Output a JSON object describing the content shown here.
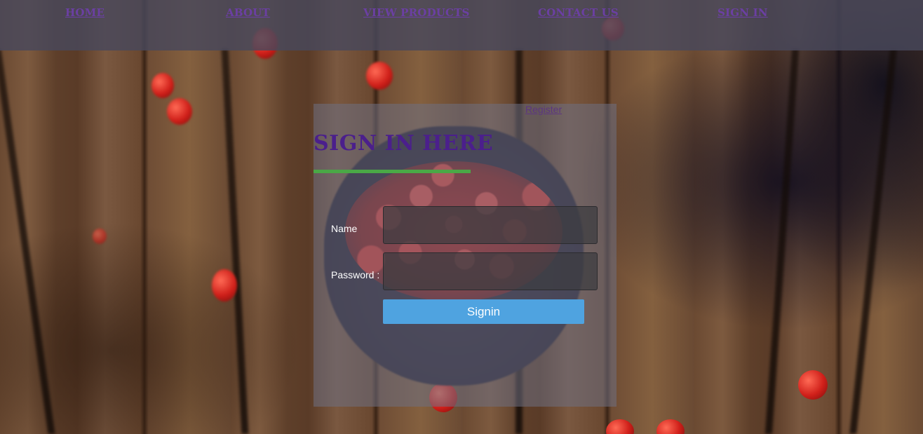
{
  "nav": {
    "home": "HOME",
    "about": "ABOUT",
    "products": "VIEW PRODUCTS",
    "contact": "CONTACT US",
    "signin": "SIGN IN"
  },
  "login": {
    "register_link": "Register",
    "heading": "SIGN IN HERE",
    "name_label": "Name",
    "name_value": "",
    "password_label": "Password :",
    "password_value": "",
    "submit_label": "Signin"
  },
  "colors": {
    "nav_link": "#6b3fa3",
    "heading": "#4b1f8c",
    "underline_accent": "#4aa846",
    "button": "#4fa3e0"
  }
}
